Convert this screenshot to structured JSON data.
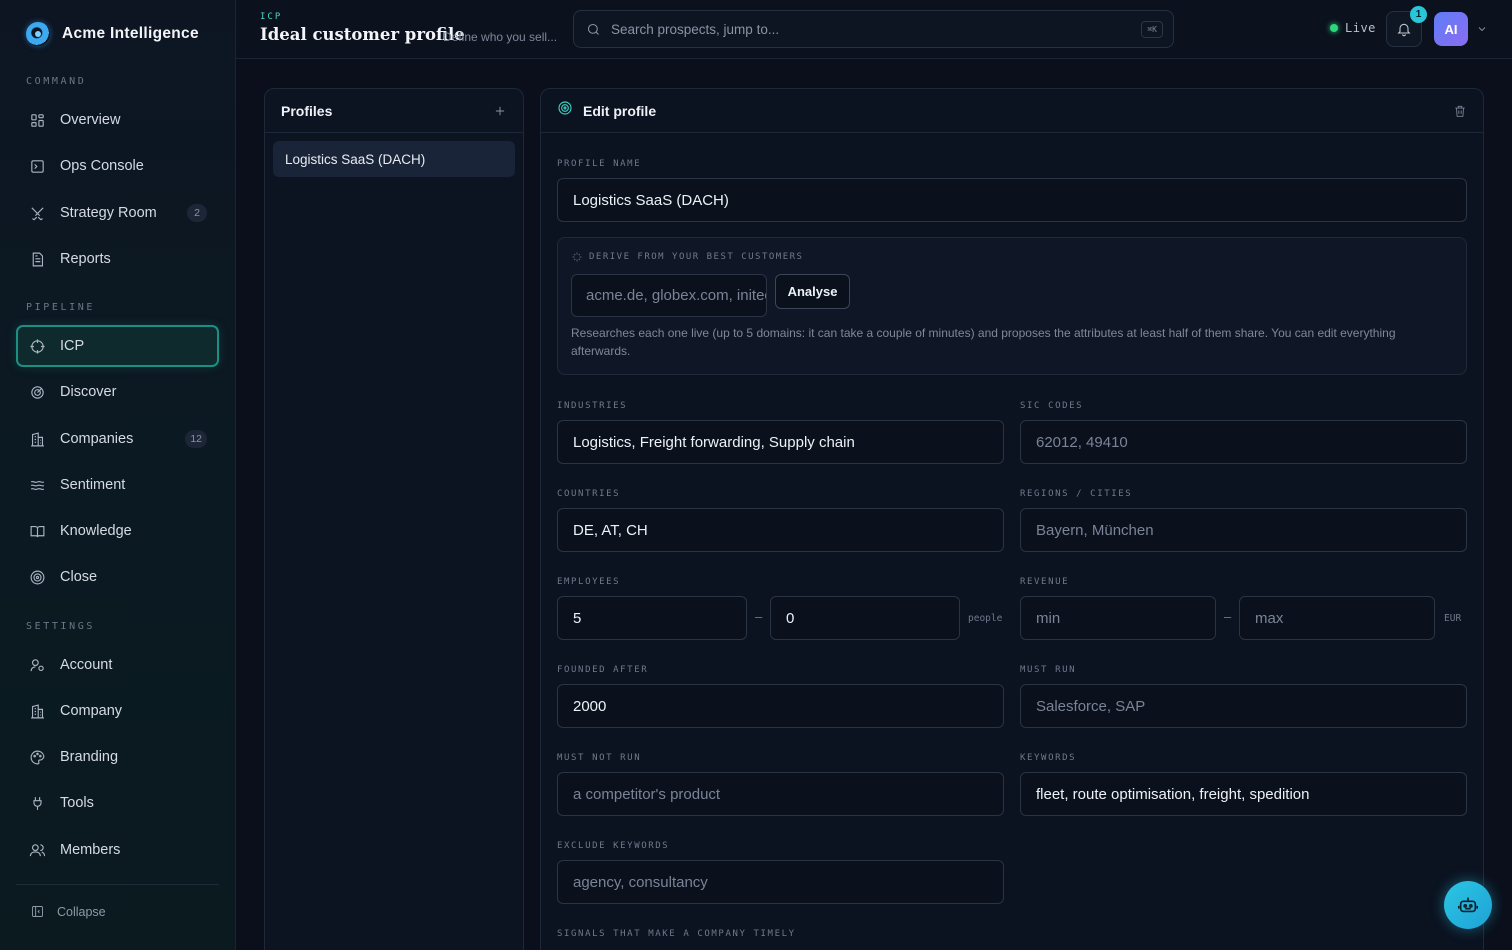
{
  "app": {
    "name": "Acme Intelligence"
  },
  "sidebar": {
    "sections": {
      "command": "COMMAND",
      "pipeline": "PIPELINE",
      "settings": "SETTINGS"
    },
    "items": [
      {
        "label": "Overview",
        "icon": "grid-icon"
      },
      {
        "label": "Ops Console",
        "icon": "terminal-icon"
      },
      {
        "label": "Strategy Room",
        "icon": "swords-icon",
        "badge": "2"
      },
      {
        "label": "Reports",
        "icon": "document-icon"
      },
      {
        "label": "ICP",
        "icon": "crosshair-icon",
        "active": true
      },
      {
        "label": "Discover",
        "icon": "radar-icon"
      },
      {
        "label": "Companies",
        "icon": "building-icon",
        "badge": "12"
      },
      {
        "label": "Sentiment",
        "icon": "waves-icon"
      },
      {
        "label": "Knowledge",
        "icon": "book-icon"
      },
      {
        "label": "Close",
        "icon": "target-icon"
      },
      {
        "label": "Account",
        "icon": "user-settings-icon"
      },
      {
        "label": "Company",
        "icon": "building-icon"
      },
      {
        "label": "Branding",
        "icon": "palette-icon"
      },
      {
        "label": "Tools",
        "icon": "plug-icon"
      },
      {
        "label": "Members",
        "icon": "users-icon"
      }
    ],
    "collapse_label": "Collapse"
  },
  "header": {
    "crumb": "ICP",
    "title": "Ideal customer profile",
    "subtitle": "Define who you sell...",
    "search_placeholder": "Search prospects, jump to...",
    "shortcut": "⌘K",
    "status": "Live",
    "notifications": "1",
    "avatar": "AI"
  },
  "profiles": {
    "title": "Profiles",
    "items": [
      "Logistics SaaS (DACH)"
    ]
  },
  "edit": {
    "title": "Edit profile",
    "profile_name": {
      "label": "PROFILE NAME",
      "value": "Logistics SaaS (DACH)"
    },
    "derive": {
      "label": "DERIVE FROM YOUR BEST CUSTOMERS",
      "placeholder": "acme.de, globex.com, initech.io",
      "button": "Analyse",
      "help": "Researches each one live (up to 5 domains: it can take a couple of minutes) and proposes the attributes at least half of them share. You can edit everything afterwards."
    },
    "industries": {
      "label": "INDUSTRIES",
      "value": "Logistics, Freight forwarding, Supply chain"
    },
    "sic_codes": {
      "label": "SIC CODES",
      "placeholder": "62012, 49410"
    },
    "countries": {
      "label": "COUNTRIES",
      "value": "DE, AT, CH"
    },
    "regions": {
      "label": "REGIONS / CITIES",
      "placeholder": "Bayern, München"
    },
    "employees": {
      "label": "EMPLOYEES",
      "min": "5",
      "max": "0",
      "unit": "people"
    },
    "revenue": {
      "label": "REVENUE",
      "min_placeholder": "min",
      "max_placeholder": "max",
      "unit": "EUR"
    },
    "founded_after": {
      "label": "FOUNDED AFTER",
      "value": "2000"
    },
    "must_run": {
      "label": "MUST RUN",
      "placeholder": "Salesforce, SAP"
    },
    "must_not_run": {
      "label": "MUST NOT RUN",
      "placeholder": "a competitor's product"
    },
    "keywords": {
      "label": "KEYWORDS",
      "value": "fleet, route optimisation, freight, spedition"
    },
    "exclude_keywords": {
      "label": "EXCLUDE KEYWORDS",
      "placeholder": "agency, consultancy"
    },
    "signals": {
      "label": "SIGNALS THAT MAKE A COMPANY TIMELY"
    }
  },
  "colors": {
    "accent": "#1d8f82",
    "teal": "#46d7c4",
    "live": "#2fd57f",
    "fab": "#2cc6e3"
  }
}
